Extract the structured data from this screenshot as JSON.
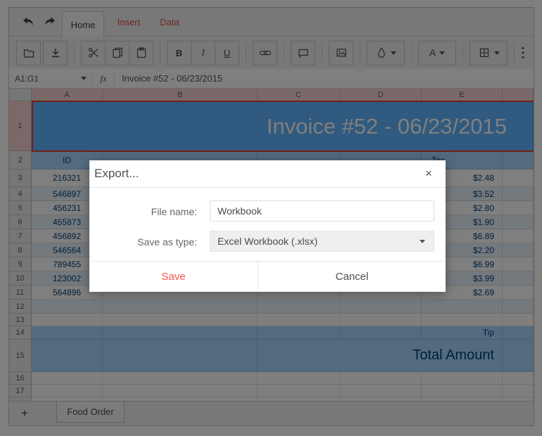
{
  "tabs": {
    "home": "Home",
    "insert": "Insert",
    "data": "Data"
  },
  "toolbar": {
    "bold": "B",
    "italic": "I",
    "underline": "U",
    "font_color": "A"
  },
  "formula_bar": {
    "name_box": "A1:G1",
    "fx": "fx",
    "value": "Invoice #52 - 06/23/2015"
  },
  "sheet": {
    "columns": [
      "A",
      "B",
      "C",
      "D",
      "E"
    ],
    "row_numbers": [
      "1",
      "2",
      "3",
      "4",
      "5",
      "6",
      "7",
      "8",
      "9",
      "10",
      "11",
      "12",
      "13",
      "14",
      "15",
      "16",
      "17"
    ],
    "title": "Invoice #52 - 06/23/2015",
    "header": {
      "id": "ID",
      "tax": "Tax"
    },
    "data": [
      {
        "id": "216321",
        "tax": "$2.48"
      },
      {
        "id": "546897",
        "tax": "$3.52"
      },
      {
        "id": "456231",
        "tax": "$2.80"
      },
      {
        "id": "455873",
        "tax": "$1.90"
      },
      {
        "id": "456892",
        "tax": "$6.89"
      },
      {
        "id": "546564",
        "tax": "$2.20"
      },
      {
        "id": "789455",
        "tax": "$6.99"
      },
      {
        "id": "123002",
        "tax": "$3.99"
      },
      {
        "id": "564896",
        "tax": "$2.69"
      }
    ],
    "tip_label": "Tip",
    "total_label": "Total Amount"
  },
  "sheet_bar": {
    "add": "+",
    "tab": "Food Order"
  },
  "dialog": {
    "title": "Export...",
    "close": "×",
    "file_name_label": "File name:",
    "file_name_value": "Workbook",
    "save_as_label": "Save as type:",
    "save_as_value": "Excel Workbook (.xlsx)",
    "save": "Save",
    "cancel": "Cancel"
  },
  "colors": {
    "accent_red": "#f5554a",
    "title_blue": "#60b5ff",
    "header_blue": "#a7d6ff",
    "band_blue": "#e9f3fd",
    "navy_text": "#003e75",
    "selection_red": "#e8402f"
  }
}
